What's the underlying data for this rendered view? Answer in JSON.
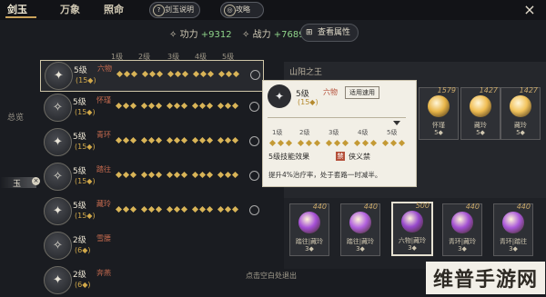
{
  "tabs": [
    {
      "label": "剑玉"
    },
    {
      "label": "万象"
    },
    {
      "label": "照命"
    }
  ],
  "pills": {
    "jade_desc": "剑玉说明",
    "strategy": "攻略"
  },
  "close_glyph": "×",
  "stats": {
    "power_label": "功力",
    "power_value": "+9312",
    "combat_label": "战力",
    "combat_value": "+7689",
    "view_attrs": "查看属性"
  },
  "left": {
    "overview": "总览",
    "jade_label": "玉"
  },
  "header_levels": [
    "1级",
    "2级",
    "3级",
    "4级",
    "5级"
  ],
  "rows": [
    {
      "level": "5级",
      "name": "六物",
      "sub": "(15◆)",
      "icon": "✦"
    },
    {
      "level": "5级",
      "name": "怀瑾",
      "sub": "(15◆)",
      "icon": "✧"
    },
    {
      "level": "5级",
      "name": "青环",
      "sub": "(15◆)",
      "icon": "✦"
    },
    {
      "level": "5级",
      "name": "踏往",
      "sub": "(15◆)",
      "icon": "✧"
    },
    {
      "level": "5级",
      "name": "藏玲",
      "sub": "(15◆)",
      "icon": "✦"
    },
    {
      "level": "2级",
      "name": "雪腰",
      "sub": "(6◆)",
      "icon": "✧"
    },
    {
      "level": "2级",
      "name": "奔燕",
      "sub": "(6◆)",
      "icon": "✦"
    }
  ],
  "right_title": "山阳之王",
  "cards_top": [
    {
      "num": "1579",
      "label": "怀瑾",
      "count": "5◆",
      "gem": "#e8b548"
    },
    {
      "num": "1427",
      "label": "藏玲",
      "count": "5◆",
      "gem": "#f0bd52"
    },
    {
      "num": "1427",
      "label": "藏玲",
      "count": "5◆",
      "gem": "#f2c35c"
    }
  ],
  "cards_bottom": [
    {
      "num": "440",
      "label": "踏往|藏玲",
      "count": "3◆",
      "gem": "#a54fd6"
    },
    {
      "num": "440",
      "label": "踏往|藏玲",
      "count": "3◆",
      "gem": "#b160de"
    },
    {
      "num": "500",
      "label": "六物|藏玲",
      "count": "3◆",
      "gem": "#9748cc"
    },
    {
      "num": "440",
      "label": "青环|藏玲",
      "count": "3◆",
      "gem": "#a24fd2"
    },
    {
      "num": "440",
      "label": "青环|踏往",
      "count": "3◆",
      "gem": "#aa58da"
    }
  ],
  "popup": {
    "level": "5级",
    "name": "六物",
    "btn": "适用速用",
    "sub": "(15◆)",
    "levels": [
      "1级",
      "2级",
      "3级",
      "4级",
      "5级"
    ],
    "effect": "5级技能效果",
    "badge": "禁",
    "set": "侠义禁",
    "desc": "提升4%治疗率，处于套路一时减半。"
  },
  "hint": "点击空白处退出",
  "watermark": "维普手游网"
}
